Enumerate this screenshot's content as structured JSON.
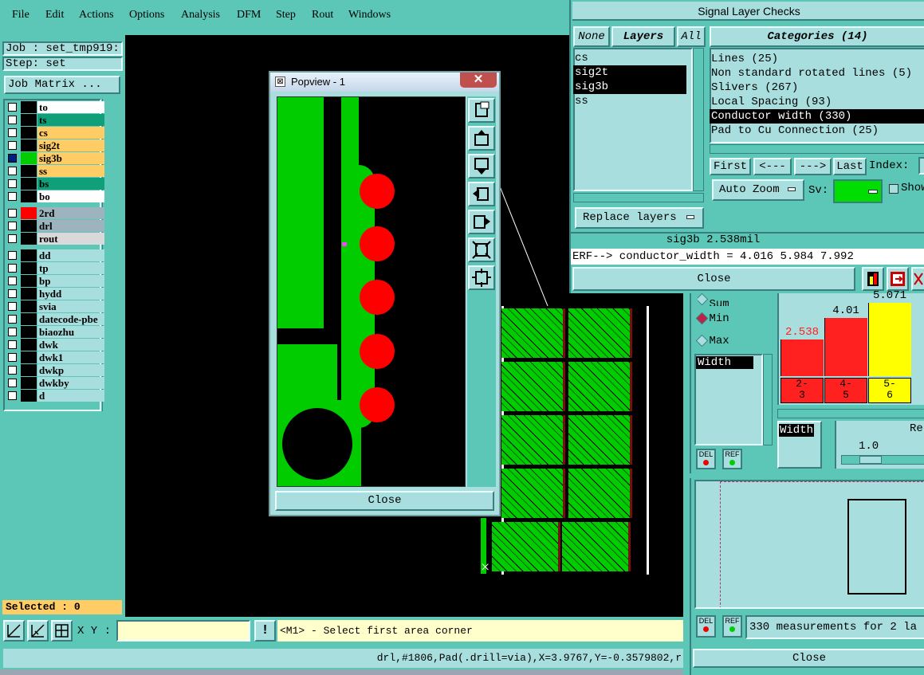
{
  "menu": {
    "items": [
      "File",
      "Edit",
      "Actions",
      "Options",
      "Analysis",
      "DFM",
      "Step",
      "Rout",
      "Windows"
    ]
  },
  "job": {
    "job_label": "Job : set_tmp919:",
    "step_label": "Step: set",
    "matrix_button": "Job Matrix ..."
  },
  "layers_group1": [
    {
      "name": "to",
      "color": "#ffffff",
      "bg": "#000000",
      "checked": false
    },
    {
      "name": "ts",
      "color": "#0fa07a",
      "bg": "#000000",
      "checked": false
    },
    {
      "name": "cs",
      "color": "#ffcc66",
      "bg": "#000000",
      "checked": false
    },
    {
      "name": "sig2t",
      "color": "#ffcc66",
      "bg": "#000000",
      "checked": false
    },
    {
      "name": "sig3b",
      "color": "#ffcc66",
      "bg": "#00cc00",
      "checked": true
    },
    {
      "name": "ss",
      "color": "#ffcc66",
      "bg": "#000000",
      "checked": false
    },
    {
      "name": "bs",
      "color": "#0fa07a",
      "bg": "#000000",
      "checked": false
    },
    {
      "name": "bo",
      "color": "#ffffff",
      "bg": "#000000",
      "checked": false
    }
  ],
  "layers_group2": [
    {
      "name": "2rd",
      "color": "#9db3bd",
      "bg": "#ff0000",
      "checked": false
    },
    {
      "name": "drl",
      "color": "#9db3bd",
      "bg": "#000000",
      "checked": false
    },
    {
      "name": "rout",
      "color": "#d9d9d9",
      "bg": "#000000",
      "checked": false
    }
  ],
  "layers_group3": [
    {
      "name": "dd"
    },
    {
      "name": "tp"
    },
    {
      "name": "bp"
    },
    {
      "name": "hydd"
    },
    {
      "name": "svia"
    },
    {
      "name": "datecode-pbe"
    },
    {
      "name": "biaozhu"
    },
    {
      "name": "dwk"
    },
    {
      "name": "dwk1"
    },
    {
      "name": "dwkp"
    },
    {
      "name": "dwkby"
    },
    {
      "name": "d"
    }
  ],
  "status": {
    "selected": "Selected : 0",
    "xy_label": "X Y :",
    "xy_value": "",
    "prompt": "<M1> - Select first area corner",
    "bottom_info": "drl,#1806,Pad(.drill=via),X=3.9767,Y=-0.3579802,r"
  },
  "popview": {
    "title": "Popview - 1",
    "close": "Close"
  },
  "signal_checks": {
    "title": "Signal Layer Checks",
    "tab_none": "None",
    "tab_layers": "Layers",
    "tab_all": "All",
    "layers": [
      "cs",
      "sig2t",
      "sig3b",
      "ss"
    ],
    "categories_title": "Categories (14)",
    "categories": [
      "Lines (25)",
      "Non standard rotated lines (5)",
      "Slivers (267)",
      "Local Spacing (93)",
      "Conductor width (330)",
      "Pad to Cu Connection (25)"
    ],
    "first": "First",
    "prev": "<---",
    "next": "--->",
    "last": "Last",
    "index": "Index:",
    "auto_zoom": "Auto Zoom",
    "sv": "Sv:",
    "show": "Show",
    "replace_layers": "Replace layers",
    "measure": "sig3b 2.538mil",
    "erf": "ERF--> conductor_width = 4.016 5.984 7.992",
    "close": "Close"
  },
  "histogram": {
    "options": [
      "Sum",
      "Min",
      "Max"
    ],
    "width_label": "Width",
    "bars": [
      {
        "label": "2.538",
        "value": 2.538,
        "color": "#ff2020",
        "cat": "2-\n3"
      },
      {
        "label": "4.01",
        "value": 4.01,
        "color": "#ff2020",
        "cat": "4-\n5"
      },
      {
        "label": "5.071",
        "value": 5.071,
        "color": "#ffff00",
        "cat": "5-\n6"
      }
    ],
    "width_btn": "Width",
    "res_label": "Re",
    "slider_value": "1.0",
    "del": "DEL",
    "ref": "REF",
    "measurements": "330 measurements for 2 la",
    "close": "Close"
  },
  "colors": {
    "teal": "#5cc7b7",
    "green_copper": "#00cc00",
    "pad_red": "#ff0000",
    "selection": "#000000"
  }
}
